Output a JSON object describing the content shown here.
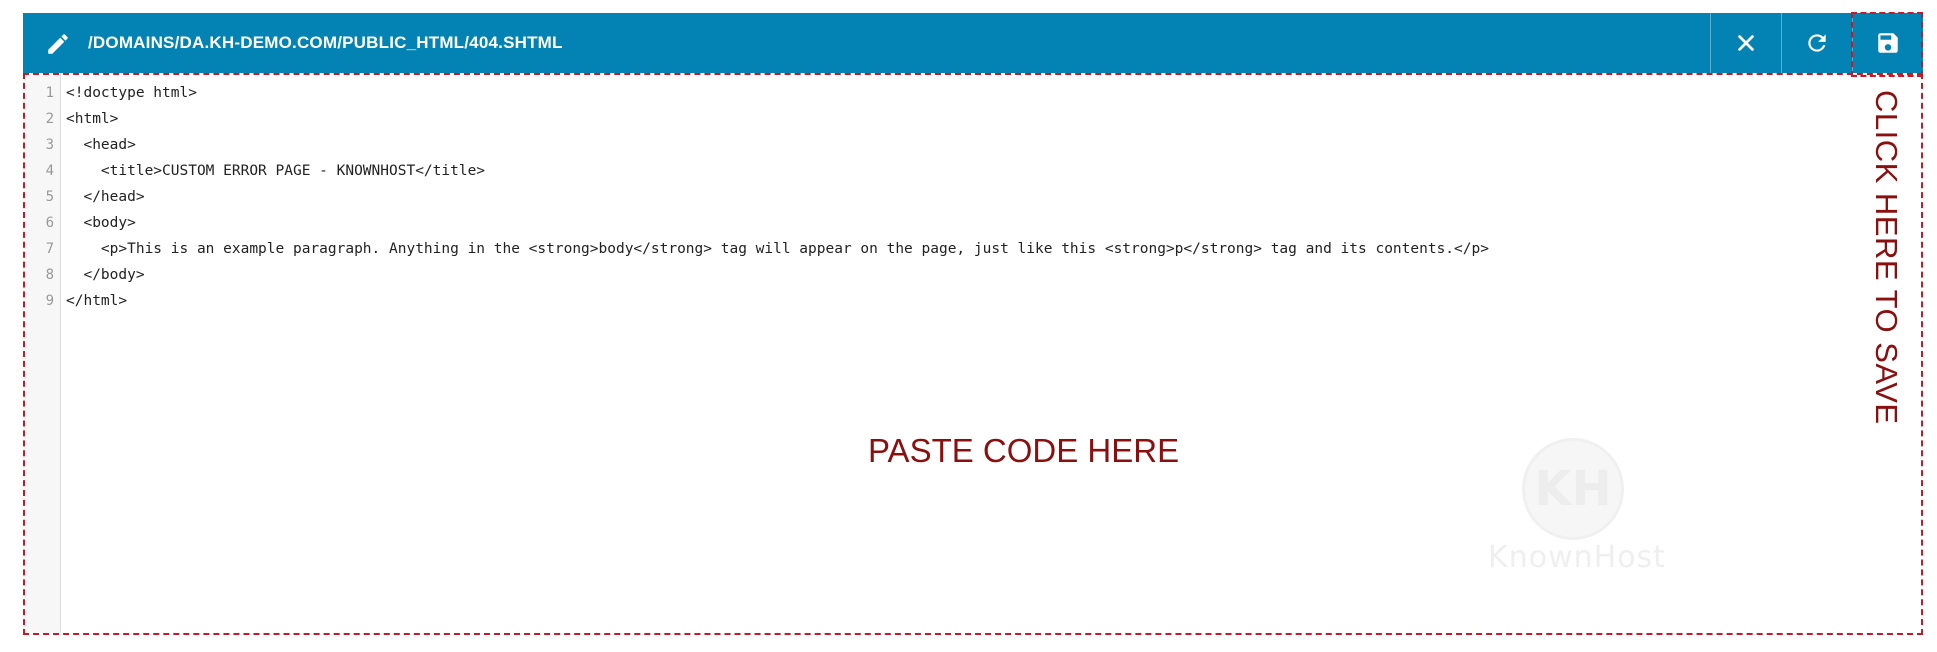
{
  "header": {
    "file_path": "/DOMAINS/DA.KH-DEMO.COM/PUBLIC_HTML/404.SHTML",
    "bg_color": "#0283b3",
    "icons": {
      "edit": "pencil-icon",
      "close": "close-icon",
      "refresh": "refresh-icon",
      "save": "floppy-disk-icon"
    }
  },
  "editor": {
    "lines": [
      {
        "number": "1",
        "text": "<!doctype html>"
      },
      {
        "number": "2",
        "text": "<html>"
      },
      {
        "number": "3",
        "text": "  <head>"
      },
      {
        "number": "4",
        "text": "    <title>CUSTOM ERROR PAGE - KNOWNHOST</title>"
      },
      {
        "number": "5",
        "text": "  </head>"
      },
      {
        "number": "6",
        "text": "  <body>"
      },
      {
        "number": "7",
        "text": "    <p>This is an example paragraph. Anything in the <strong>body</strong> tag will appear on the page, just like this <strong>p</strong> tag and its contents.</p>"
      },
      {
        "number": "8",
        "text": "  </body>"
      },
      {
        "number": "9",
        "text": "</html>"
      }
    ]
  },
  "annotations": {
    "paste_label": "PASTE CODE HERE",
    "save_label": "CLICK HERE TO SAVE",
    "color": "#c8192a"
  },
  "watermark": {
    "logo_letters": "KH",
    "brand": "KnownHost"
  }
}
